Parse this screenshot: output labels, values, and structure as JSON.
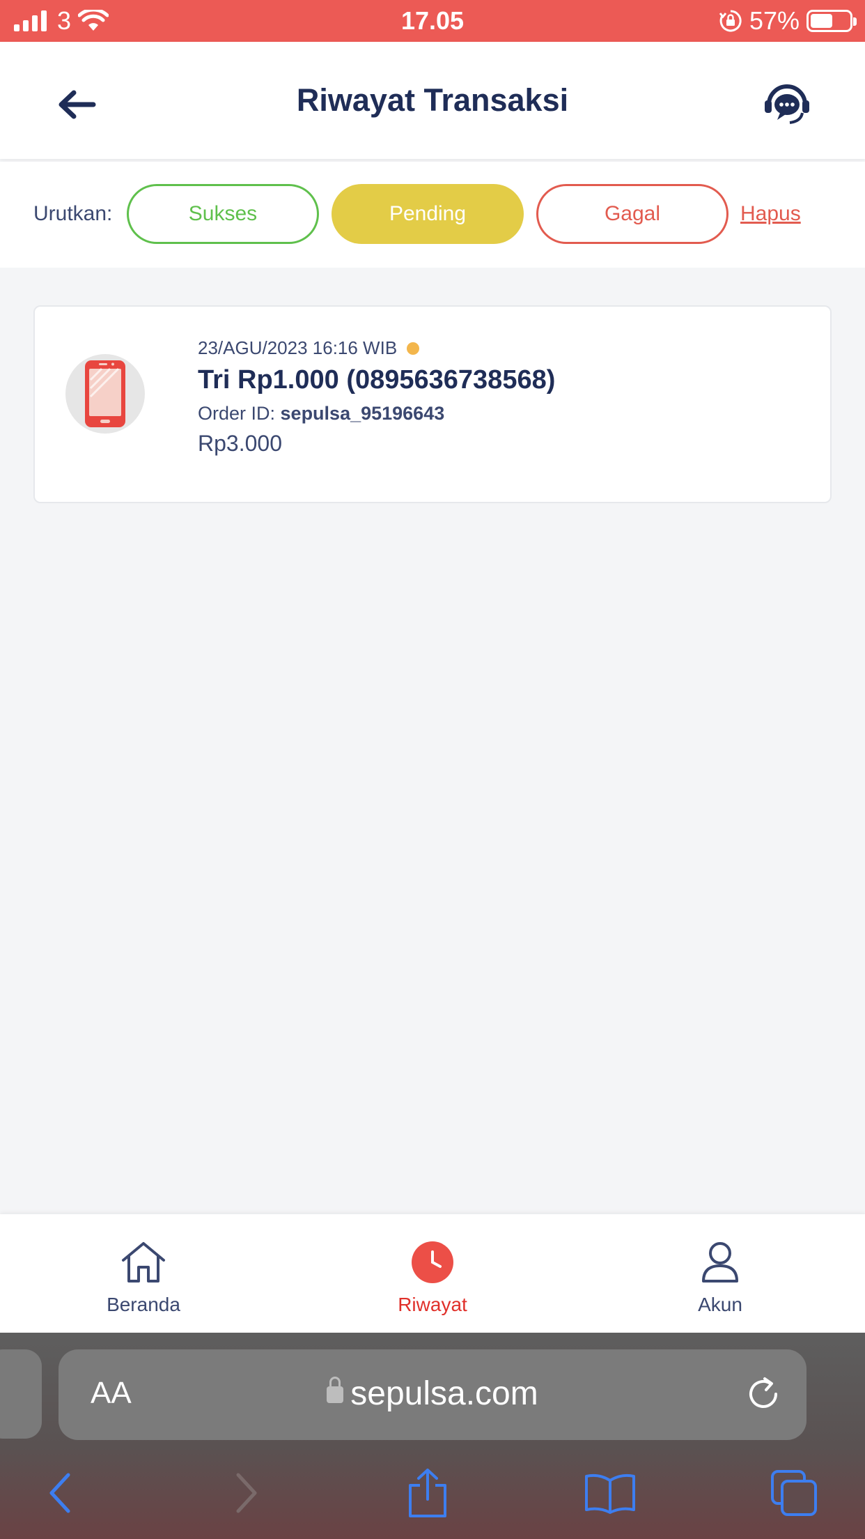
{
  "status_bar": {
    "carrier": "3",
    "time": "17.05",
    "battery": "57%",
    "battery_level": 0.57
  },
  "header": {
    "title": "Riwayat Transaksi"
  },
  "filter": {
    "label": "Urutkan:",
    "sukses": "Sukses",
    "pending": "Pending",
    "gagal": "Gagal",
    "clear": "Hapus"
  },
  "transaction": {
    "date": "23/AGU/2023 16:16 WIB",
    "status_color": "#f3b64c",
    "title": "Tri Rp1.000 (0895636738568)",
    "order_label": "Order ID: ",
    "order_id": "sepulsa_95196643",
    "amount": "Rp3.000",
    "icon": "smartphone-icon"
  },
  "bottom_nav": {
    "beranda": "Beranda",
    "riwayat": "Riwayat",
    "akun": "Akun"
  },
  "browser": {
    "text_size": "AA",
    "url": "sepulsa.com"
  },
  "colors": {
    "accent": "#ec5a55",
    "navy": "#1f2d57",
    "success": "#5fc04c",
    "pending": "#e3cc47",
    "failed": "#e25b4f"
  }
}
